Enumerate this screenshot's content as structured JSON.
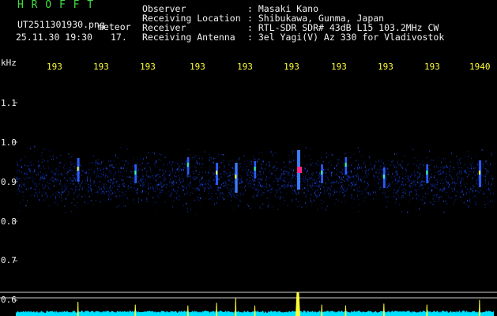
{
  "header": {
    "app_title": "H R O F F T",
    "file_name": "UT2511301930.png",
    "detection_label": "meteor",
    "datetime": "25.11.30 19:30",
    "count": "17."
  },
  "info": [
    {
      "label": "Observer",
      "value": ": Masaki Kano"
    },
    {
      "label": "Receiving Location",
      "value": ": Shibukawa, Gunma, Japan"
    },
    {
      "label": "Receiver",
      "value": ": RTL-SDR SDR# 43dB L15 103.2MHz CW"
    },
    {
      "label": "Receiving Antenna",
      "value": ": 3el Yagi(V) Az 330 for Vladivostok"
    }
  ],
  "colors": {
    "header_accent": "#3fe03f",
    "text": "#f0f0f0",
    "time_ticks": "#ffff33",
    "power_trace": "#00e0ff",
    "meteor_peak": "#ffff33",
    "background": "#000000"
  },
  "chart_data": {
    "type": "heatmap",
    "ylabel": "kHz",
    "y_ticks": [
      "1.1",
      "1.0",
      "0.9",
      "0.8",
      "0.7",
      "0.6"
    ],
    "x_ticks": [
      "193",
      "193",
      "193",
      "193",
      "193",
      "193",
      "193",
      "193",
      "193",
      "1940"
    ],
    "time_range_minutes": [
      1930,
      1940
    ],
    "frequency_range_khz": [
      0.6,
      1.15
    ],
    "noise_band_khz": [
      0.82,
      0.99
    ],
    "meteor_echoes": [
      {
        "time": 1931.3,
        "freq_khz": 0.93,
        "strength": 0.5
      },
      {
        "time": 1932.5,
        "freq_khz": 0.92,
        "strength": 0.35
      },
      {
        "time": 1933.6,
        "freq_khz": 0.94,
        "strength": 0.3
      },
      {
        "time": 1934.2,
        "freq_khz": 0.92,
        "strength": 0.45
      },
      {
        "time": 1934.6,
        "freq_khz": 0.91,
        "strength": 0.7
      },
      {
        "time": 1935.0,
        "freq_khz": 0.93,
        "strength": 0.3
      },
      {
        "time": 1935.9,
        "freq_khz": 0.93,
        "strength": 1.0
      },
      {
        "time": 1936.4,
        "freq_khz": 0.92,
        "strength": 0.35
      },
      {
        "time": 1936.9,
        "freq_khz": 0.94,
        "strength": 0.3
      },
      {
        "time": 1937.7,
        "freq_khz": 0.91,
        "strength": 0.4
      },
      {
        "time": 1938.6,
        "freq_khz": 0.92,
        "strength": 0.35
      },
      {
        "time": 1939.7,
        "freq_khz": 0.92,
        "strength": 0.6
      }
    ]
  }
}
